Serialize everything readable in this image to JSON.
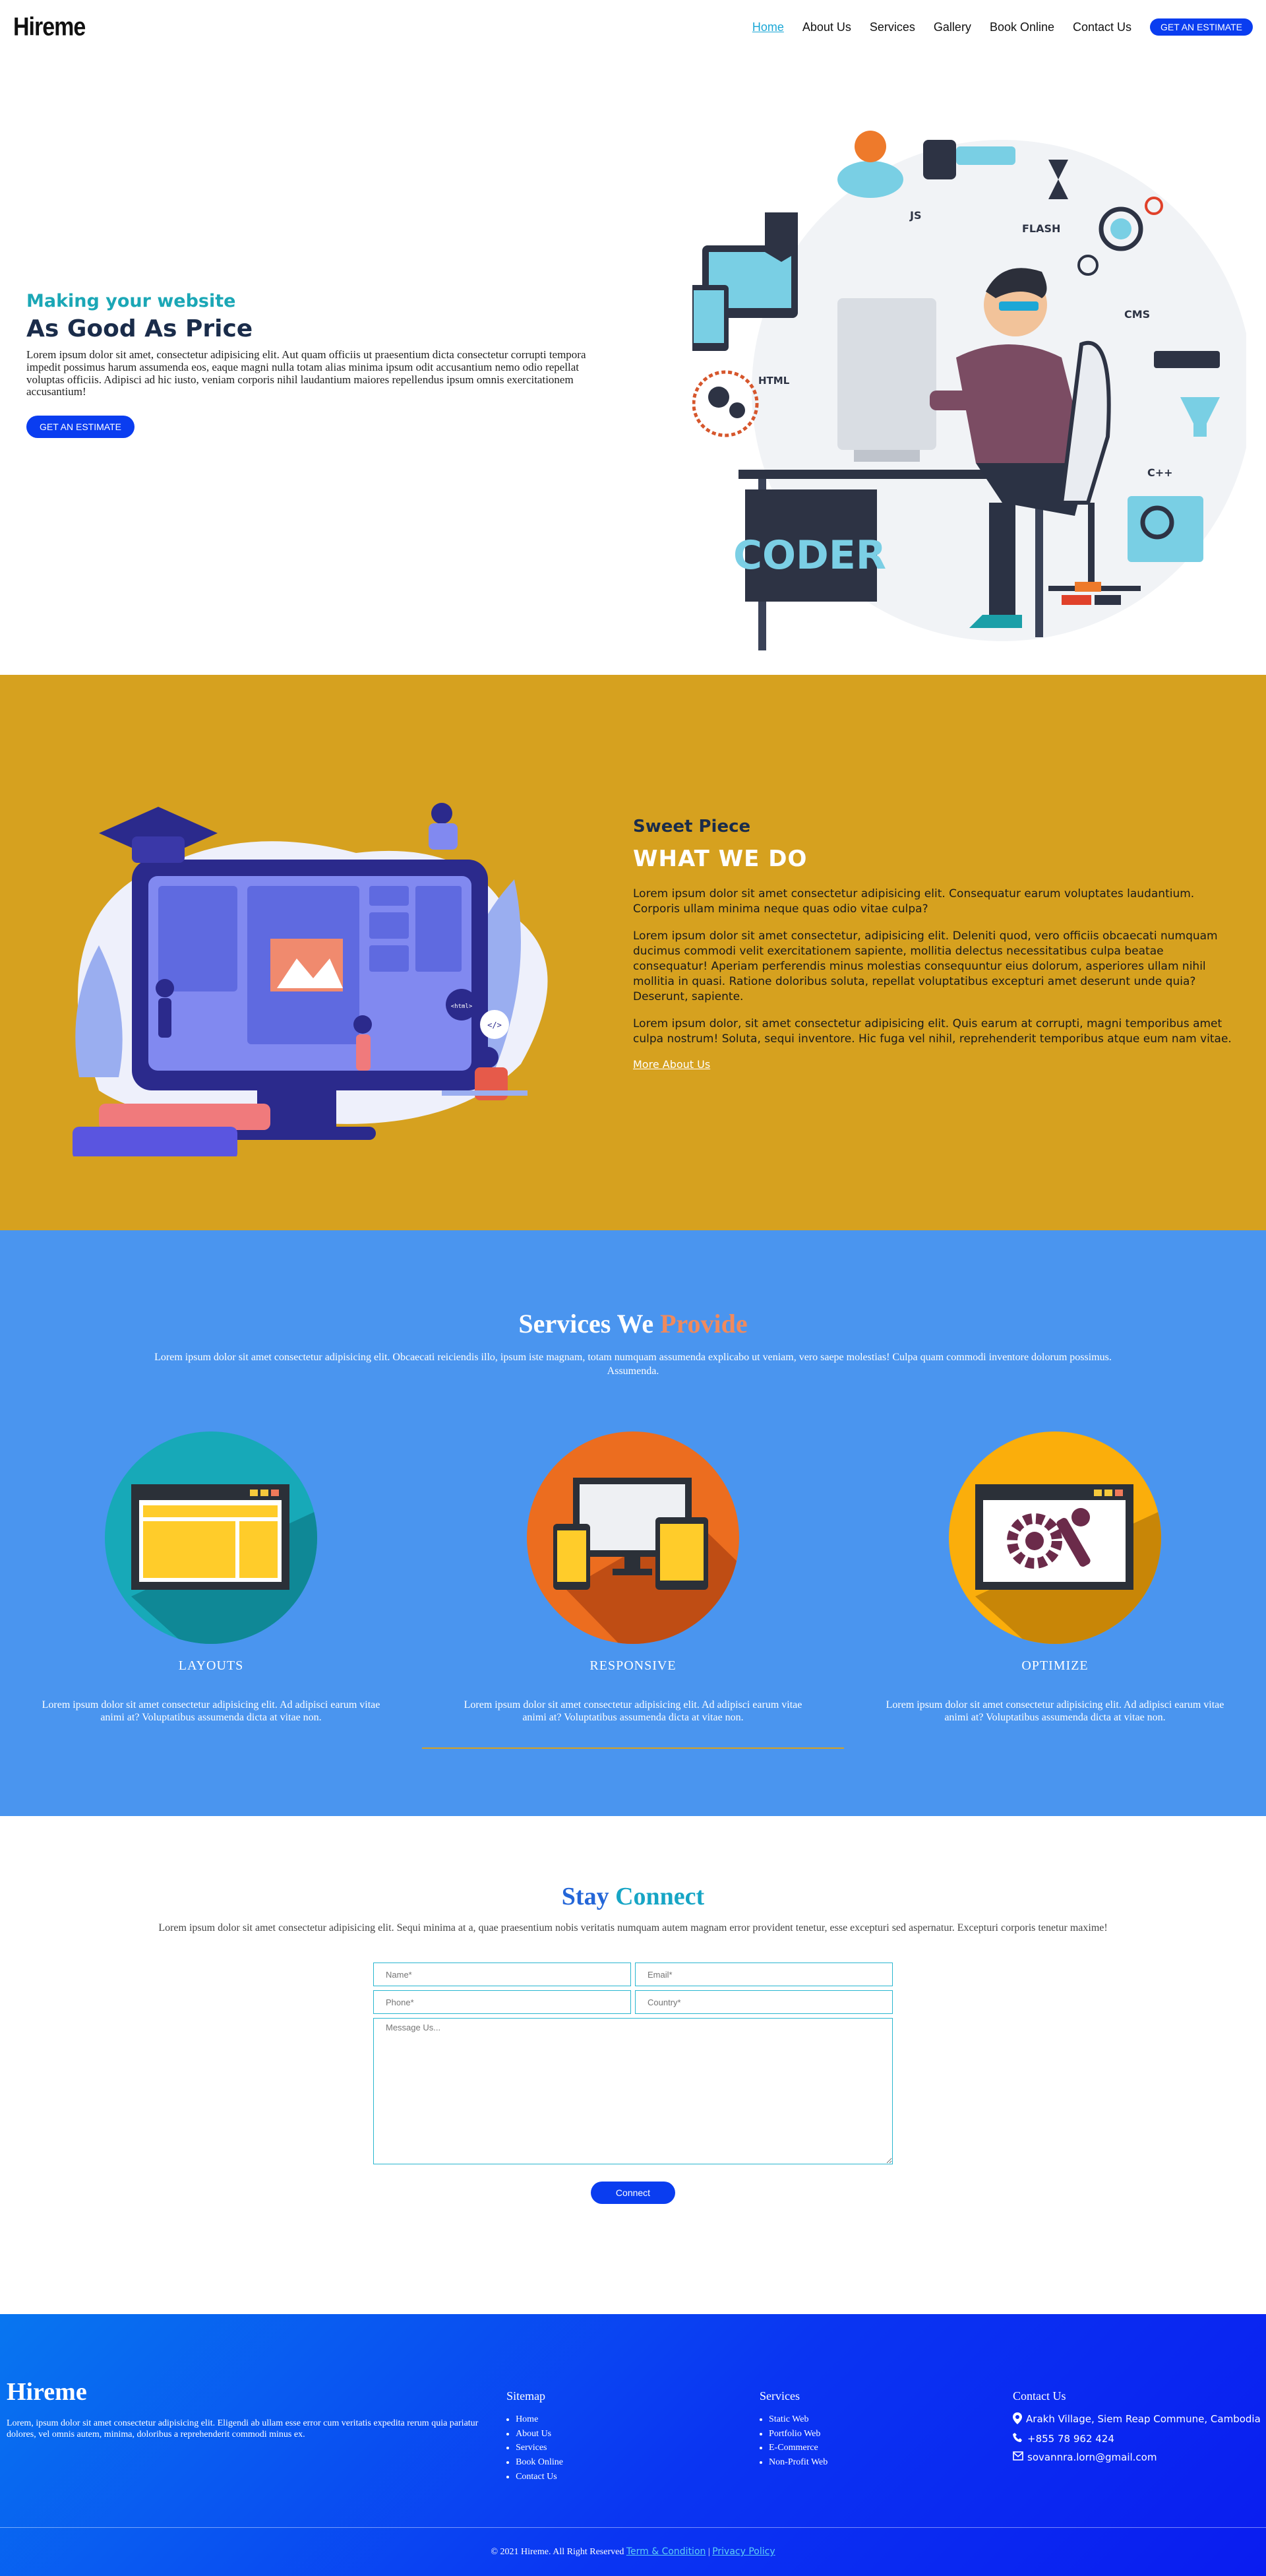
{
  "nav": {
    "logo": "Hireme",
    "links": [
      "Home",
      "About Us",
      "Services",
      "Gallery",
      "Book Online",
      "Contact Us"
    ],
    "cta": "GET AN ESTIMATE"
  },
  "hero": {
    "subtitle": "Making your website",
    "title": "As Good As Price",
    "text": "Lorem ipsum dolor sit amet, consectetur adipisicing elit. Aut quam officiis ut praesentium dicta consectetur corrupti tempora impedit possimus harum assumenda eos, eaque magni nulla totam alias minima ipsum odit accusantium nemo odio repellat voluptas officiis. Adipisci ad hic iusto, veniam corporis nihil laudantium maiores repellendus ipsum omnis exercitationem accusantium!",
    "cta": "GET AN ESTIMATE",
    "art_labels": {
      "coder": "CODER",
      "html": "HTML",
      "flash": "FLASH",
      "cms": "CMS",
      "js": "JS",
      "cpp": "C++"
    }
  },
  "what": {
    "subtitle": "Sweet Piece",
    "title": "WHAT WE DO",
    "paragraphs": [
      "Lorem ipsum dolor sit amet consectetur adipisicing elit. Consequatur earum voluptates laudantium. Corporis ullam minima neque quas odio vitae culpa?",
      "Lorem ipsum dolor sit amet consectetur, adipisicing elit. Deleniti quod, vero officiis obcaecati numquam ducimus commodi velit exercitationem sapiente, mollitia delectus necessitatibus culpa beatae consequatur! Aperiam perferendis minus molestias consequuntur eius dolorum, asperiores ullam nihil mollitia in quasi. Ratione doloribus soluta, repellat voluptatibus excepturi amet deserunt unde quia? Deserunt, sapiente.",
      "Lorem ipsum dolor, sit amet consectetur adipisicing elit. Quis earum at corrupti, magni temporibus amet culpa nostrum! Soluta, sequi inventore. Hic fuga vel nihil, reprehenderit temporibus atque eum nam vitae."
    ],
    "more": "More About Us",
    "art_labels": {
      "code": "</>",
      "html": "<html>"
    }
  },
  "services": {
    "title_a": "Services We ",
    "title_b": "Provide",
    "lead": "Lorem ipsum dolor sit amet consectetur adipisicing elit. Obcaecati reiciendis illo, ipsum iste magnam, totam numquam assumenda explicabo ut veniam, vero saepe molestias! Culpa quam commodi inventore dolorum possimus. Assumenda.",
    "items": [
      {
        "name": "LAYOUTS",
        "text": "Lorem ipsum dolor sit amet consectetur adipisicing elit. Ad adipisci earum vitae animi at? Voluptatibus assumenda dicta at vitae non.",
        "color": "#17a9b8"
      },
      {
        "name": "RESPONSIVE",
        "text": "Lorem ipsum dolor sit amet consectetur adipisicing elit. Ad adipisci earum vitae animi at? Voluptatibus assumenda dicta at vitae non.",
        "color": "#ec6d1f"
      },
      {
        "name": "OPTIMIZE",
        "text": "Lorem ipsum dolor sit amet consectetur adipisicing elit. Ad adipisci earum vitae animi at? Voluptatibus assumenda dicta at vitae non.",
        "color": "#fbae0b"
      }
    ]
  },
  "connect": {
    "title_a": "Stay ",
    "title_b": "Connect",
    "lead": "Lorem ipsum dolor sit amet consectetur adipisicing elit. Sequi minima at a, quae praesentium nobis veritatis numquam autem magnam error provident tenetur, esse excepturi sed aspernatur. Excepturi corporis tenetur maxime!",
    "placeholders": {
      "name": "Name*",
      "email": "Email*",
      "phone": "Phone*",
      "country": "Country*",
      "message": "Message Us..."
    },
    "button": "Connect"
  },
  "footer": {
    "brand": "Hireme",
    "about": "Lorem, ipsum dolor sit amet consectetur adipisicing elit. Eligendi ab ullam esse error cum veritatis expedita rerum quia pariatur dolores, vel omnis autem, minima, doloribus a reprehenderit commodi minus ex.",
    "sitemap_title": "Sitemap",
    "sitemap": [
      "Home",
      "About Us",
      "Services",
      "Book Online",
      "Contact Us"
    ],
    "services_title": "Services",
    "services": [
      "Static Web",
      "Portfolio Web",
      "E-Commerce",
      "Non-Profit Web"
    ],
    "contact_title": "Contact Us",
    "address": "Arakh Village, Siem Reap Commune, Cambodia",
    "phone": "+855 78 962 424",
    "email": "sovannra.lorn@gmail.com",
    "copyright": "© 2021 Hireme.  All Right Reserved",
    "terms": "Term & Condition",
    "sep": "|",
    "privacy": "Privacy Policy"
  }
}
